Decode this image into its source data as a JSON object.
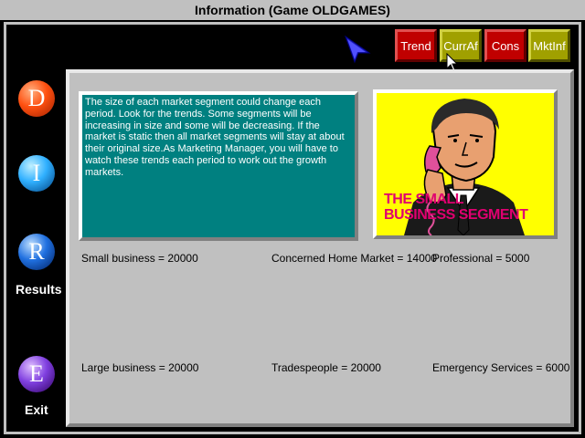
{
  "window": {
    "title": "Information (Game OLDGAMES)"
  },
  "toolbar": [
    {
      "label": "Trend",
      "color": "red"
    },
    {
      "label": "CurrAf",
      "color": "olive"
    },
    {
      "label": "Cons",
      "color": "red"
    },
    {
      "label": "MktInf",
      "color": "olive"
    }
  ],
  "sidebar": {
    "d_letter": "D",
    "i_letter": "I",
    "r_letter": "R",
    "results_label": "Results",
    "e_letter": "E",
    "exit_label": "Exit"
  },
  "info_text": "The size of each market segment could change each period. Look for the trends. Some segments will be increasing in size and some will be decreasing. If the market is static then all market segments will stay at about their original size.As Marketing Manager, you will have to watch these trends each period to work out the growth markets.",
  "image": {
    "title_line1": "THE SMALL",
    "title_line2": "BUSINESS SEGMENT"
  },
  "segments": {
    "small_business": "Small business = 20000",
    "concerned_home": "Concerned Home Market = 14000",
    "professional": "Professional = 5000",
    "large_business": "Large business = 20000",
    "tradespeople": "Tradespeople = 20000",
    "emergency": "Emergency Services = 6000"
  },
  "colors": {
    "text_panel": "#008080",
    "image_bg": "#ffff00",
    "btn_red": "#c00000",
    "btn_olive": "#a0a000"
  }
}
